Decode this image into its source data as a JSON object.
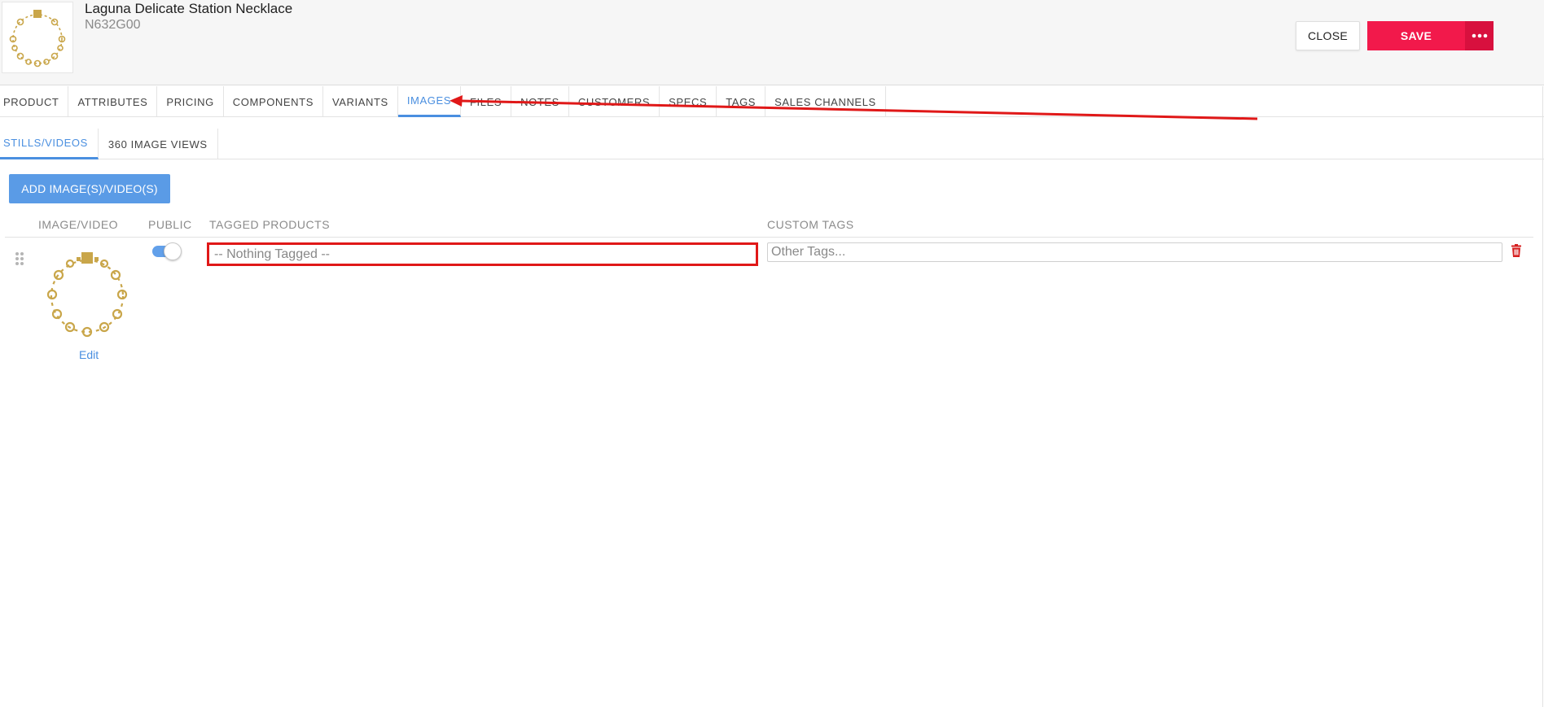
{
  "product": {
    "title": "Laguna Delicate Station Necklace",
    "sku": "N632G00"
  },
  "actions": {
    "close_label": "CLOSE",
    "save_label": "SAVE",
    "more_label": "•••"
  },
  "main_tabs": [
    {
      "label": "PRODUCT"
    },
    {
      "label": "ATTRIBUTES"
    },
    {
      "label": "PRICING"
    },
    {
      "label": "COMPONENTS"
    },
    {
      "label": "VARIANTS"
    },
    {
      "label": "IMAGES",
      "active": true
    },
    {
      "label": "FILES"
    },
    {
      "label": "NOTES"
    },
    {
      "label": "CUSTOMERS"
    },
    {
      "label": "SPECS"
    },
    {
      "label": "TAGS"
    },
    {
      "label": "SALES CHANNELS"
    }
  ],
  "sub_tabs": [
    {
      "label": "STILLS/VIDEOS",
      "active": true
    },
    {
      "label": "360 IMAGE VIEWS"
    }
  ],
  "add_button_label": "ADD IMAGE(S)/VIDEO(S)",
  "table": {
    "columns": {
      "image": "IMAGE/VIDEO",
      "public": "PUBLIC",
      "tagged": "TAGGED PRODUCTS",
      "custom": "CUSTOM TAGS"
    },
    "rows": [
      {
        "edit_label": "Edit",
        "public": true,
        "tagged_placeholder": "-- Nothing Tagged --",
        "custom_placeholder": "Other Tags..."
      }
    ]
  },
  "colors": {
    "accent": "#4a8fe0",
    "save": "#f2194b",
    "more": "#d8103e",
    "annotation": "#e01818"
  },
  "icons": [
    "necklace-thumbnail",
    "more-dots-icon",
    "drag-handle-icon",
    "trash-icon",
    "annotation-arrow"
  ]
}
